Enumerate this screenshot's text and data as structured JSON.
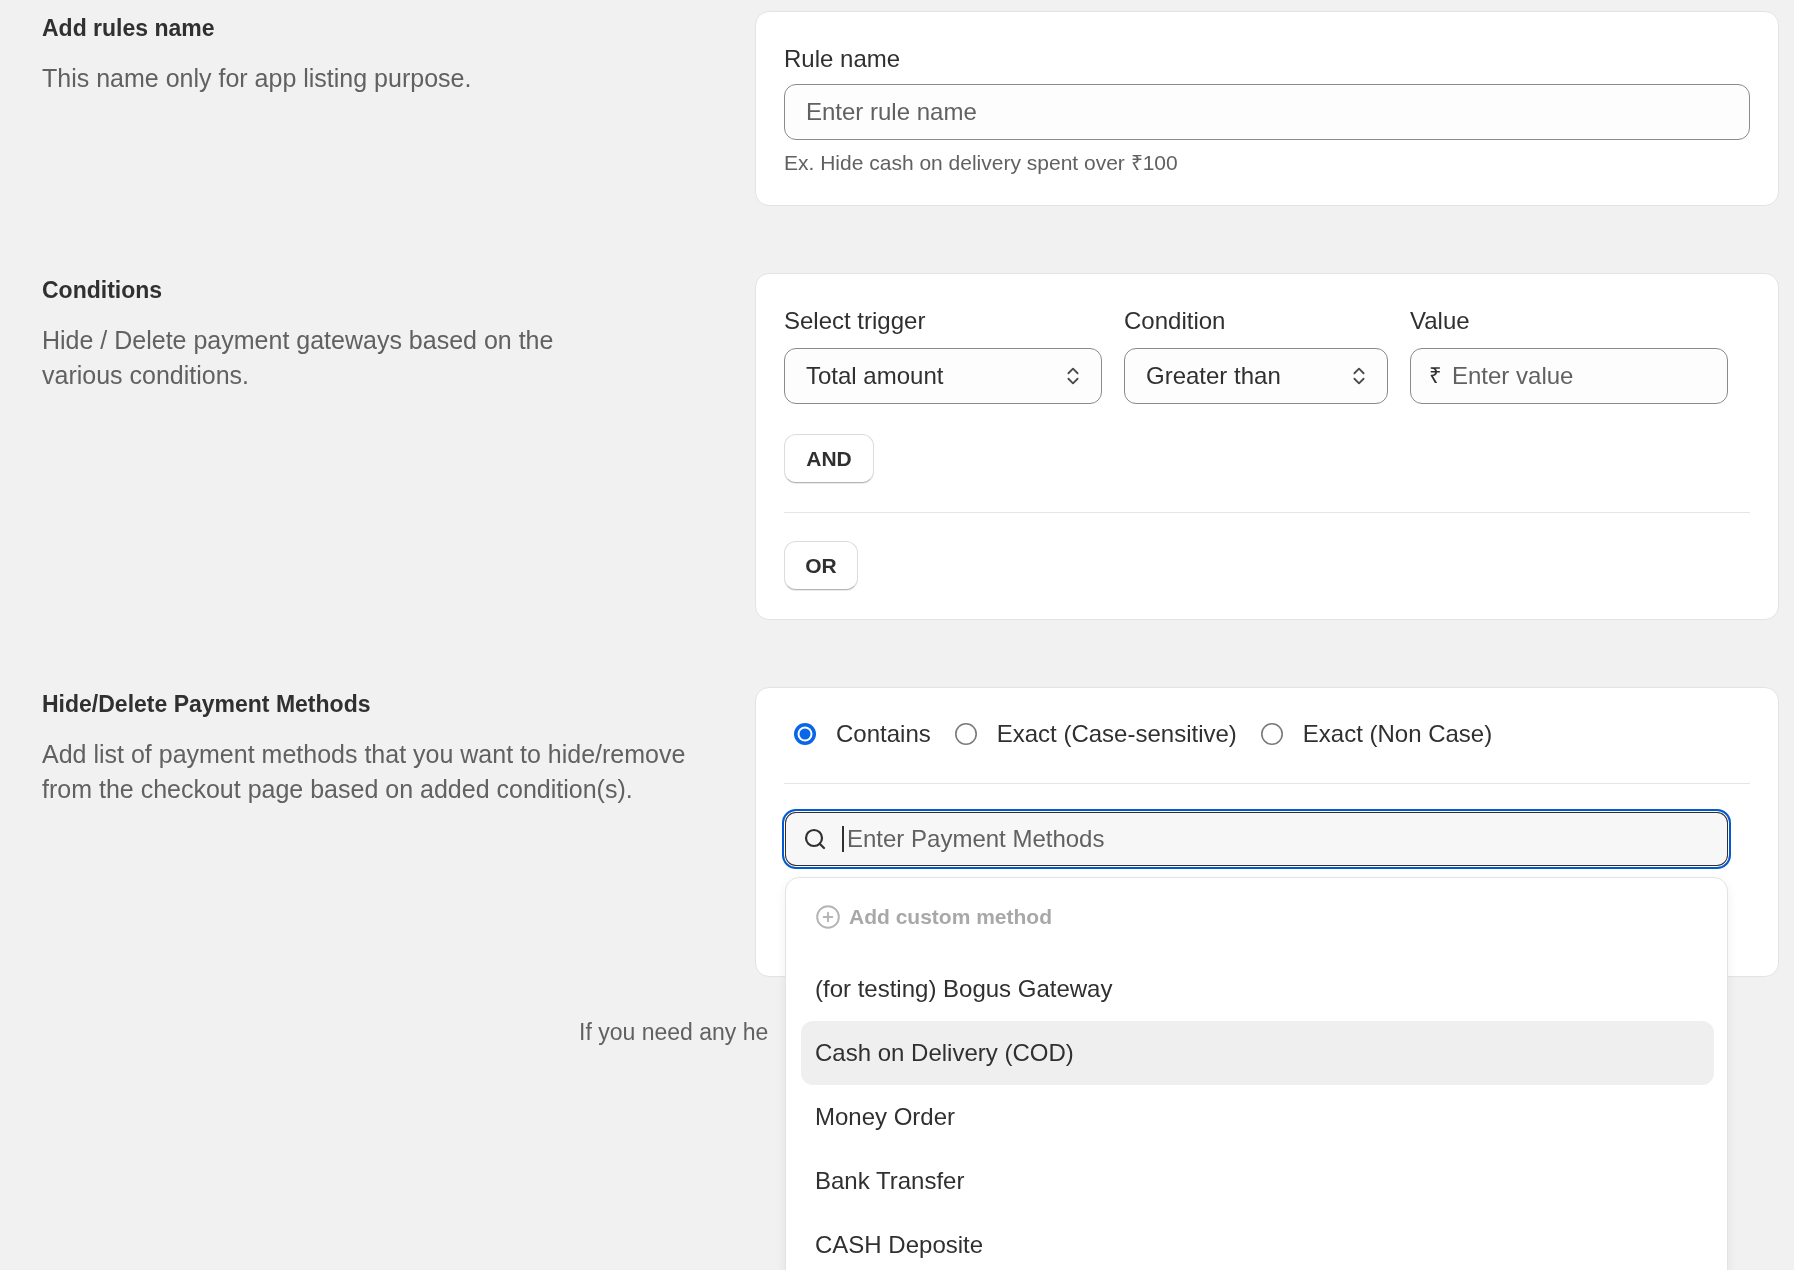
{
  "rule_name_section": {
    "title": "Add rules name",
    "description": "This name only for app listing purpose.",
    "field": {
      "label": "Rule name",
      "placeholder": "Enter rule name",
      "help_text": "Ex. Hide cash on delivery spent over ₹100"
    }
  },
  "conditions_section": {
    "title": "Conditions",
    "description": "Hide / Delete payment gateways based on the various conditions.",
    "fields": [
      {
        "kind": "select",
        "label": "Select trigger",
        "value": "Total amount"
      },
      {
        "kind": "select",
        "label": "Condition",
        "value": "Greater than"
      },
      {
        "kind": "input",
        "label": "Value",
        "prefix": "₹",
        "placeholder": "Enter value"
      }
    ],
    "and_button": "AND",
    "or_button": "OR"
  },
  "payment_methods_section": {
    "title": "Hide/Delete Payment Methods",
    "description": "Add list of payment methods that you want to hide/remove from the checkout page based on added condition(s).",
    "match_options": [
      {
        "label": "Contains",
        "selected": true
      },
      {
        "label": "Exact (Case-sensitive)",
        "selected": false
      },
      {
        "label": "Exact (Non Case)",
        "selected": false
      }
    ],
    "search": {
      "placeholder": "Enter Payment Methods",
      "focused": true
    },
    "dropdown": {
      "add_custom": {
        "label": "Add custom method",
        "disabled": true
      },
      "options": [
        {
          "label": "(for testing) Bogus Gateway",
          "highlighted": false
        },
        {
          "label": "Cash on Delivery (COD)",
          "highlighted": true
        },
        {
          "label": "Money Order",
          "highlighted": false
        },
        {
          "label": "Bank Transfer",
          "highlighted": false
        },
        {
          "label": "CASH Deposite",
          "highlighted": false
        }
      ]
    }
  },
  "footer": {
    "text": "If you need any he"
  }
}
